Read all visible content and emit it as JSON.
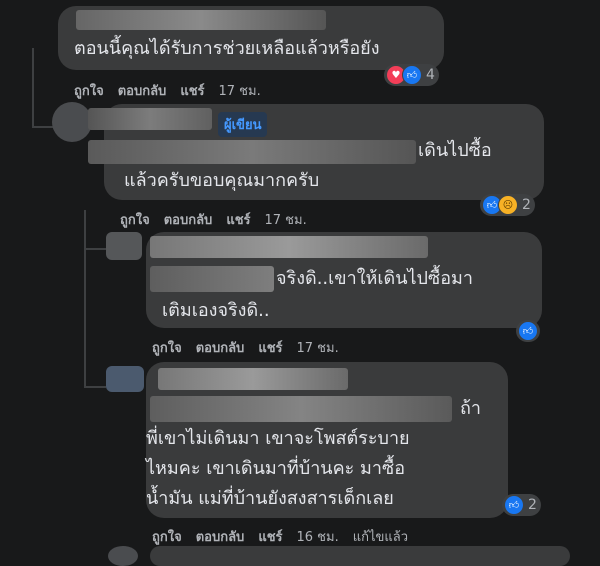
{
  "comments": [
    {
      "text_lines": [
        "ตอนนี้คุณได้รับการช่วยเหลือแล้วหรือยัง"
      ],
      "actions": {
        "like": "ถูกใจ",
        "reply": "ตอบกลับ",
        "share": "แชร์",
        "time": "17 ชม."
      },
      "reactions": {
        "count": "4",
        "icons": [
          "love",
          "like"
        ]
      }
    },
    {
      "badge": "ผู้เขียน",
      "text_lines": [
        "เดินไปซื้อ",
        "แล้วครับขอบคุณมากครับ"
      ],
      "actions": {
        "like": "ถูกใจ",
        "reply": "ตอบกลับ",
        "share": "แชร์",
        "time": "17 ชม."
      },
      "reactions": {
        "count": "2",
        "icons": [
          "like",
          "sad"
        ]
      }
    },
    {
      "text_lines": [
        "จริงดิ..เขาให้เดินไปซื้อมา",
        "เติมเองจริงดิ.."
      ],
      "actions": {
        "like": "ถูกใจ",
        "reply": "ตอบกลับ",
        "share": "แชร์",
        "time": "17 ชม."
      },
      "reactions": {
        "icons": [
          "like"
        ]
      }
    },
    {
      "text_lines": [
        "ถ้า",
        "พี่เขาไม่เดินมา เขาจะโพสต์ระบาย",
        "ไหมคะ เขาเดินมาที่บ้านคะ มาซื้อ",
        "น้ำมัน แม่ที่บ้านยังสงสารเด็กเลย"
      ],
      "actions": {
        "like": "ถูกใจ",
        "reply": "ตอบกลับ",
        "share": "แชร์",
        "time": "16 ชม.",
        "edited": "แก้ไขแล้ว"
      },
      "reactions": {
        "count": "2",
        "icons": [
          "like"
        ]
      }
    }
  ],
  "colors": {
    "background": "#18191a",
    "bubble": "#3a3b3c",
    "like": "#1877f2",
    "love": "#f33e58",
    "author": "#4599ff"
  }
}
